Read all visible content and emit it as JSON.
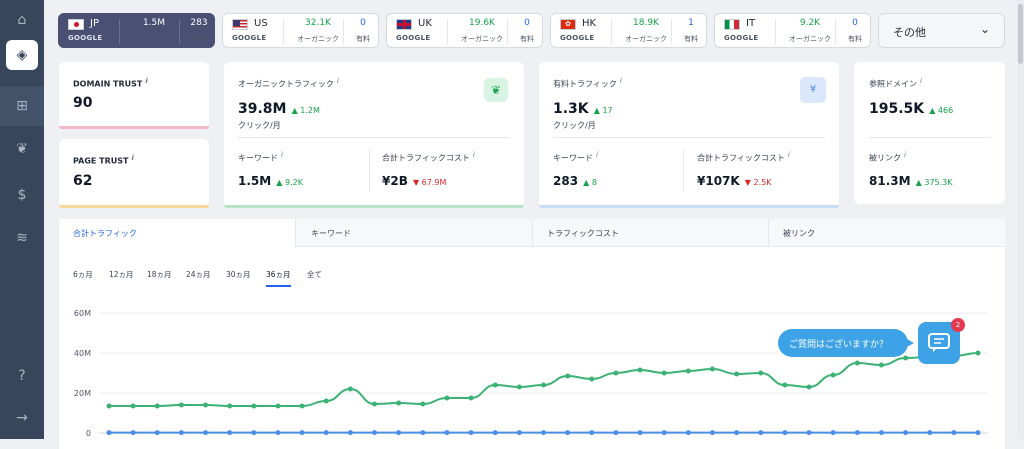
{
  "countries": [
    {
      "code": "JP",
      "google": "GOOGLE",
      "organic": "1.5M",
      "paid": "283",
      "organic_label": "オーガニック",
      "paid_label": "有料",
      "active": true
    },
    {
      "code": "US",
      "google": "GOOGLE",
      "organic": "32.1K",
      "paid": "0",
      "organic_label": "オーガニック",
      "paid_label": "有料"
    },
    {
      "code": "UK",
      "google": "GOOGLE",
      "organic": "19.6K",
      "paid": "0",
      "organic_label": "オーガニック",
      "paid_label": "有料"
    },
    {
      "code": "HK",
      "google": "GOOGLE",
      "organic": "18.9K",
      "paid": "1",
      "organic_label": "オーガニック",
      "paid_label": "有料"
    },
    {
      "code": "IT",
      "google": "GOOGLE",
      "organic": "9.2K",
      "paid": "0",
      "organic_label": "オーガニック",
      "paid_label": "有料"
    }
  ],
  "other": {
    "label": "その他",
    "chevron": "⌄"
  },
  "domain_trust": {
    "label": "DOMAIN TRUST",
    "info": "i",
    "value": "90"
  },
  "page_trust": {
    "label": "PAGE TRUST",
    "info": "i",
    "value": "62"
  },
  "organic": {
    "title": "オーガニックトラフィック",
    "info": "i",
    "value": "39.8M",
    "delta": "▲ 1.2M",
    "unit": "クリック/月",
    "kw_label": "キーワード",
    "kw_value": "1.5M",
    "kw_delta": "▲ 9.2K",
    "cost_label": "合計トラフィックコスト",
    "cost_value": "¥2B",
    "cost_delta": "▼ 67.9M"
  },
  "paid": {
    "title": "有料トラフィック",
    "info": "i",
    "value": "1.3K",
    "delta": "▲ 17",
    "unit": "クリック/月",
    "icon": "¥",
    "kw_label": "キーワード",
    "kw_value": "283",
    "kw_delta": "▲ 8",
    "cost_label": "合計トラフィックコスト",
    "cost_value": "¥107K",
    "cost_delta": "▼ 2.5K"
  },
  "ref": {
    "title": "参照ドメイン",
    "info": "i",
    "value": "195.5K",
    "delta": "▲ 466",
    "bl_label": "被リンク",
    "bl_value": "81.3M",
    "bl_delta": "▲ 375.3K"
  },
  "tabs": [
    "合計トラフィック",
    "キーワード",
    "トラフィックコスト",
    "被リンク"
  ],
  "ranges": [
    "6ヵ月",
    "12ヵ月",
    "18ヵ月",
    "24ヵ月",
    "30ヵ月",
    "36ヵ月",
    "全て"
  ],
  "chat": {
    "prompt": "ご質問はございますか？",
    "badge": "2"
  },
  "colors": {
    "organic_line": "#3bb273",
    "paid_line": "#4a8ee6",
    "accent": "#2563eb"
  },
  "chart_data": {
    "type": "line",
    "yticks": [
      "60M",
      "40M",
      "20M",
      "0"
    ],
    "ylim": [
      0,
      60
    ],
    "series": [
      {
        "color": "#3bb273",
        "values": [
          13.5,
          13.5,
          13.5,
          14,
          14,
          13.5,
          13.5,
          13.5,
          13.5,
          16,
          22,
          14.5,
          15,
          14.5,
          17.5,
          17.5,
          24,
          23,
          24,
          28.5,
          27,
          30,
          31.5,
          30,
          31,
          32,
          29.5,
          30,
          24,
          23,
          29,
          35,
          34,
          37.5,
          38,
          38.5,
          40
        ]
      },
      {
        "color": "#4a8ee6",
        "values": [
          0.2,
          0.2,
          0.2,
          0.2,
          0.2,
          0.2,
          0.2,
          0.2,
          0.2,
          0.2,
          0.2,
          0.2,
          0.2,
          0.2,
          0.2,
          0.2,
          0.2,
          0.2,
          0.2,
          0.2,
          0.2,
          0.2,
          0.2,
          0.2,
          0.2,
          0.2,
          0.2,
          0.2,
          0.2,
          0.2,
          0.2,
          0.2,
          0.2,
          0.2,
          0.2,
          0.2,
          0.2
        ]
      }
    ]
  }
}
